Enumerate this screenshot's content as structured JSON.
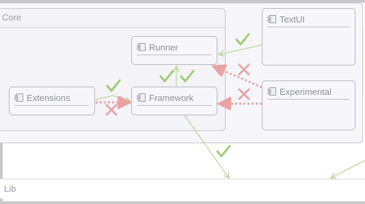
{
  "packages": {
    "core": {
      "label": "Core"
    },
    "lib": {
      "label": "Lib"
    }
  },
  "components": {
    "runner": {
      "label": "Runner"
    },
    "extensions": {
      "label": "Extensions"
    },
    "framework": {
      "label": "Framework"
    },
    "textui": {
      "label": "TextUI"
    },
    "experimental": {
      "label": "Experimental"
    }
  },
  "icons": {
    "component": "component-icon",
    "allowed": "check-icon",
    "forbidden": "cross-icon"
  },
  "colors": {
    "allowed": "#b9d79c",
    "forbidden": "#e8a3a3",
    "check": "#9ccc70"
  }
}
